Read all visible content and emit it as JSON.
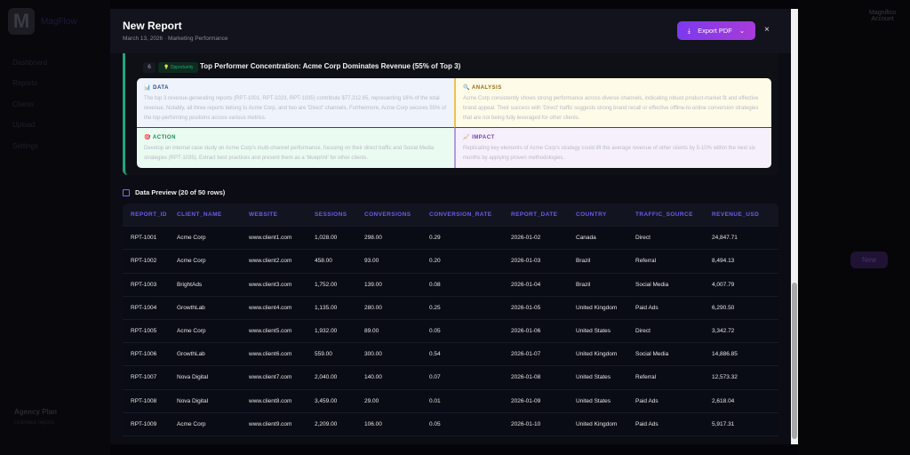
{
  "app": {
    "brand": "MagFlow",
    "nav": [
      "Dashboard",
      "Reports",
      "Clients",
      "Upload",
      "Settings"
    ],
    "plan": "Agency Plan",
    "plan_sub": "Unlimited reports",
    "user": "Magnifico",
    "user_role": "Account",
    "new_label": "New"
  },
  "modal": {
    "title": "New Report",
    "subtitle": "March 13, 2026 · Marketing Performance",
    "export_label": "Export PDF",
    "close": "×"
  },
  "insight": {
    "number": "6",
    "badge": "💡 Opportunity",
    "title": "Top Performer Concentration: Acme Corp Dominates Revenue (55% of Top 3)",
    "data_label": "DATA",
    "data_text": "The top 3 revenue-generating reports (RPT-1001, RPT-1023, RPT-1035) contribute $77,312.65, representing 16% of the total revenue. Notably, all three reports belong to Acme Corp, and two are 'Direct' channels. Furthermore, Acme Corp secures 55% of the top-performing positions across various metrics.",
    "analysis_label": "ANALYSIS",
    "analysis_text": "Acme Corp consistently shows strong performance across diverse channels, indicating robust product-market fit and effective brand appeal. Their success with 'Direct' traffic suggests strong brand recall or effective offline-to-online conversion strategies that are not being fully leveraged for other clients.",
    "action_label": "ACTION",
    "action_text": "Develop an internal case study on Acme Corp's multi-channel performance, focusing on their direct traffic and Social Media strategies (RPT-1035). Extract best practices and present them as a 'blueprint' for other clients.",
    "impact_label": "IMPACT",
    "impact_text": "Replicating key elements of Acme Corp's strategy could lift the average revenue of other clients by 5-10% within the next six months by applying proven methodologies."
  },
  "preview": {
    "title": "Data Preview (20 of 50 rows)",
    "columns": [
      "REPORT_ID",
      "CLIENT_NAME",
      "WEBSITE",
      "SESSIONS",
      "CONVERSIONS",
      "CONVERSION_RATE",
      "REPORT_DATE",
      "COUNTRY",
      "TRAFFIC_SOURCE",
      "REVENUE_USD"
    ],
    "rows": [
      [
        "RPT-1001",
        "Acme Corp",
        "www.client1.com",
        "1,028.00",
        "298.00",
        "0.29",
        "2026-01-02",
        "Canada",
        "Direct",
        "24,847.71"
      ],
      [
        "RPT-1002",
        "Acme Corp",
        "www.client2.com",
        "458.00",
        "93.00",
        "0.20",
        "2026-01-03",
        "Brazil",
        "Referral",
        "8,494.13"
      ],
      [
        "RPT-1003",
        "BrightAds",
        "www.client3.com",
        "1,752.00",
        "139.00",
        "0.08",
        "2026-01-04",
        "Brazil",
        "Social Media",
        "4,007.79"
      ],
      [
        "RPT-1004",
        "GrowthLab",
        "www.client4.com",
        "1,135.00",
        "280.00",
        "0.25",
        "2026-01-05",
        "United Kingdom",
        "Paid Ads",
        "6,290.50"
      ],
      [
        "RPT-1005",
        "Acme Corp",
        "www.client5.com",
        "1,932.00",
        "89.00",
        "0.05",
        "2026-01-06",
        "United States",
        "Direct",
        "3,342.72"
      ],
      [
        "RPT-1006",
        "GrowthLab",
        "www.client6.com",
        "559.00",
        "300.00",
        "0.54",
        "2026-01-07",
        "United Kingdom",
        "Social Media",
        "14,886.85"
      ],
      [
        "RPT-1007",
        "Nova Digital",
        "www.client7.com",
        "2,040.00",
        "140.00",
        "0.07",
        "2026-01-08",
        "United States",
        "Referral",
        "12,573.32"
      ],
      [
        "RPT-1008",
        "Nova Digital",
        "www.client8.com",
        "3,459.00",
        "29.00",
        "0.01",
        "2026-01-09",
        "United States",
        "Paid Ads",
        "2,618.04"
      ],
      [
        "RPT-1009",
        "Acme Corp",
        "www.client9.com",
        "2,209.00",
        "106.00",
        "0.05",
        "2026-01-10",
        "United Kingdom",
        "Paid Ads",
        "5,917.31"
      ]
    ]
  }
}
